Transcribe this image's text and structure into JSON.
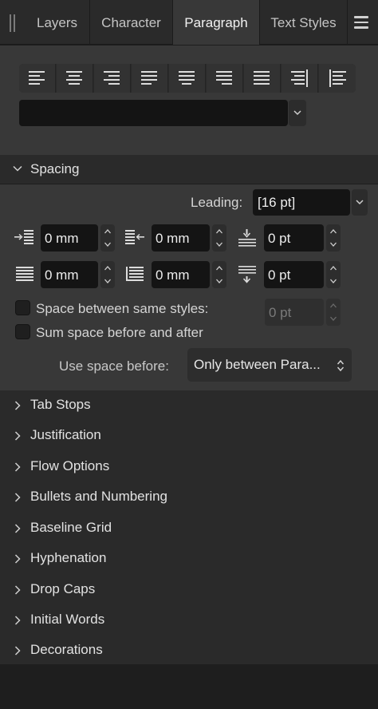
{
  "tabs": [
    {
      "label": "Layers",
      "active": false
    },
    {
      "label": "Character",
      "active": false
    },
    {
      "label": "Paragraph",
      "active": true
    },
    {
      "label": "Text Styles",
      "active": false
    }
  ],
  "alignment_buttons": [
    "align-left-icon",
    "align-center-icon",
    "align-right-icon",
    "justify-left-icon",
    "justify-center-icon",
    "justify-right-icon",
    "justify-all-icon",
    "align-towards-spine-icon",
    "align-away-from-spine-icon"
  ],
  "paragraph_style": {
    "value": ""
  },
  "spacing": {
    "title": "Spacing",
    "leading_label": "Leading:",
    "leading_value": "[16 pt]",
    "left_indent": "0 mm",
    "right_indent": "0 mm",
    "space_before": "0 pt",
    "first_line_indent": "0 mm",
    "last_line_indent": "0 mm",
    "space_after": "0 pt",
    "space_between_same_styles_label": "Space between same styles:",
    "space_between_same_styles_value": "0 pt",
    "sum_space_label": "Sum space before and after",
    "use_space_before_label": "Use space before:",
    "use_space_before_value": "Only between Para..."
  },
  "sections": [
    "Tab Stops",
    "Justification",
    "Flow Options",
    "Bullets and Numbering",
    "Baseline Grid",
    "Hyphenation",
    "Drop Caps",
    "Initial Words",
    "Decorations"
  ],
  "colors": {
    "panel_bg": "#383838",
    "header_bg": "#2a2a2a",
    "field_bg": "#141414",
    "text": "#d8d8d8"
  }
}
